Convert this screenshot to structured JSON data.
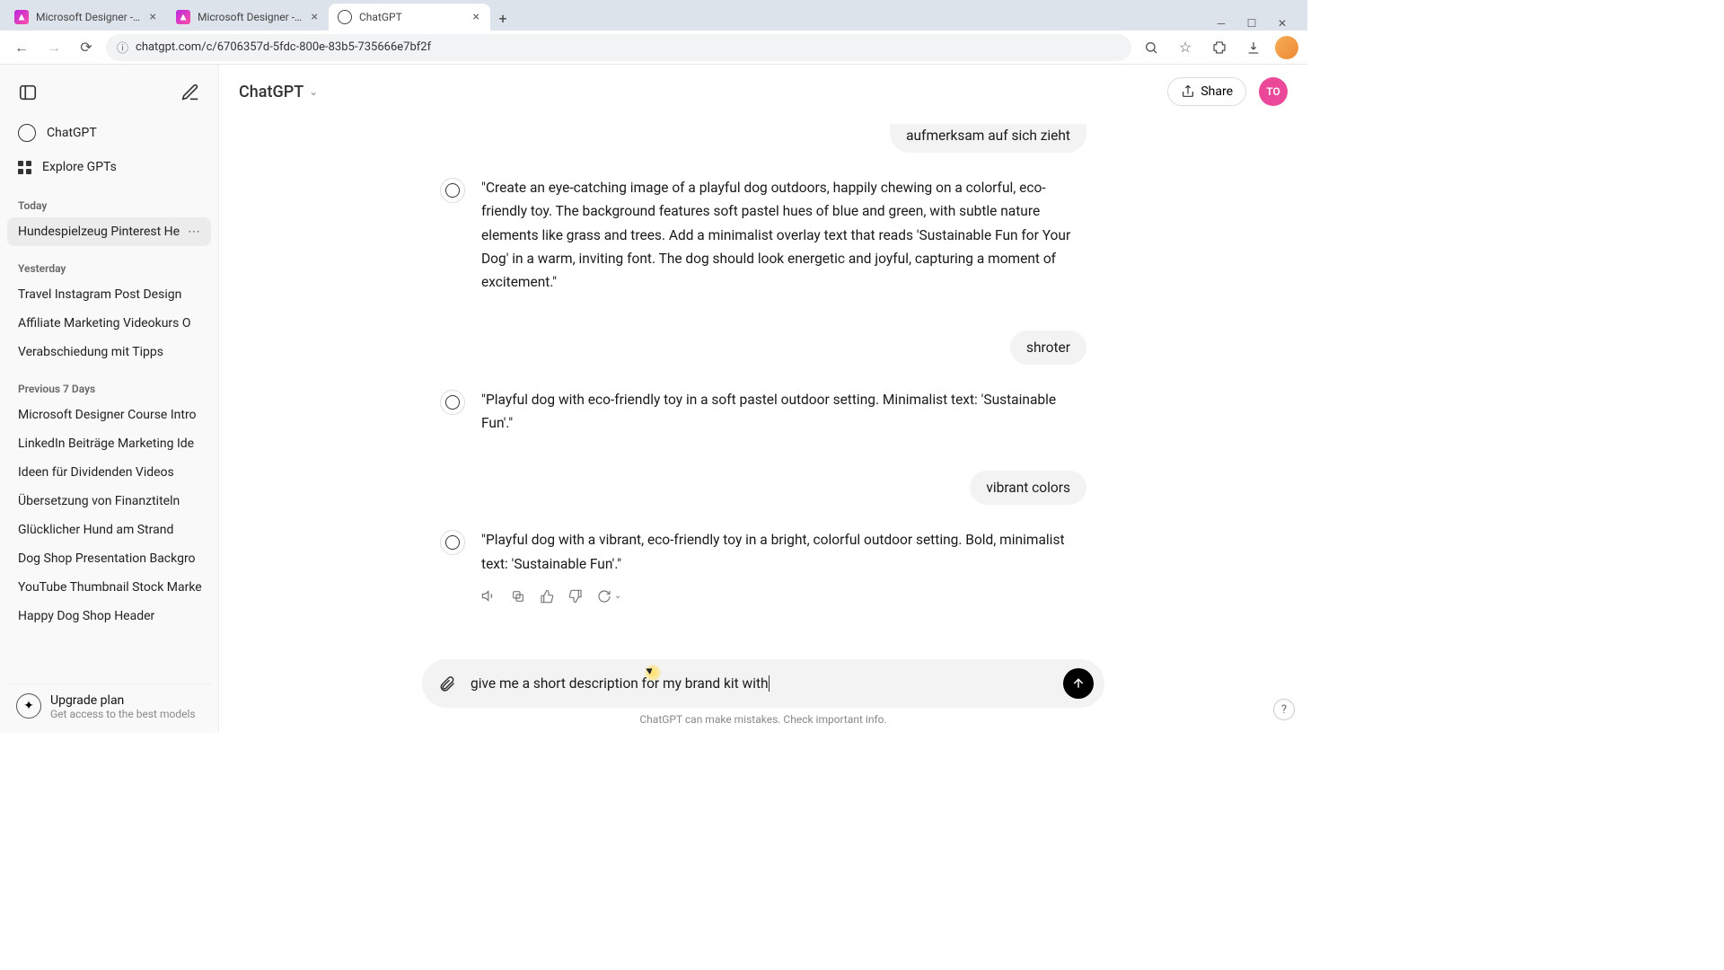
{
  "browser": {
    "tabs": [
      {
        "title": "Microsoft Designer - Stunning",
        "fav": "designer",
        "active": false
      },
      {
        "title": "Microsoft Designer - Stunning",
        "fav": "designer",
        "active": false
      },
      {
        "title": "ChatGPT",
        "fav": "chatgpt",
        "active": true
      }
    ],
    "url": "chatgpt.com/c/6706357d-5fdc-800e-83b5-735666e7bf2f"
  },
  "sidebar": {
    "nav": {
      "chatgpt": "ChatGPT",
      "explore": "Explore GPTs"
    },
    "sections": [
      {
        "label": "Today",
        "items": [
          "Hundespielzeug Pinterest He"
        ]
      },
      {
        "label": "Yesterday",
        "items": [
          "Travel Instagram Post Design",
          "Affiliate Marketing Videokurs O",
          "Verabschiedung mit Tipps"
        ]
      },
      {
        "label": "Previous 7 Days",
        "items": [
          "Microsoft Designer Course Intro",
          "LinkedIn Beiträge Marketing Ide",
          "Ideen für Dividenden Videos",
          "Übersetzung von Finanztiteln",
          "Glücklicher Hund am Strand",
          "Dog Shop Presentation Backgro",
          "YouTube Thumbnail Stock Marke",
          "Happy Dog Shop Header"
        ]
      }
    ],
    "upgrade": {
      "title": "Upgrade plan",
      "sub": "Get access to the best models"
    }
  },
  "header": {
    "model": "ChatGPT",
    "share": "Share",
    "avatar": "TO"
  },
  "chat": {
    "user_clipped": "aufmerksam auf sich zieht",
    "asst1": "\"Create an eye-catching image of a playful dog outdoors, happily chewing on a colorful, eco-friendly toy. The background features soft pastel hues of blue and green, with subtle nature elements like grass and trees. Add a minimalist overlay text that reads 'Sustainable Fun for Your Dog' in a warm, inviting font. The dog should look energetic and joyful, capturing a moment of excitement.\"",
    "user2": "shroter",
    "asst2": "\"Playful dog with eco-friendly toy in a soft pastel outdoor setting. Minimalist text: 'Sustainable Fun'.\"",
    "user3": "vibrant colors",
    "asst3": "\"Playful dog with a vibrant, eco-friendly toy in a bright, colorful outdoor setting. Bold, minimalist text: 'Sustainable Fun'.\""
  },
  "composer": {
    "value": "give me a short description for my brand kit with"
  },
  "footnote": "ChatGPT can make mistakes. Check important info.",
  "help": "?"
}
